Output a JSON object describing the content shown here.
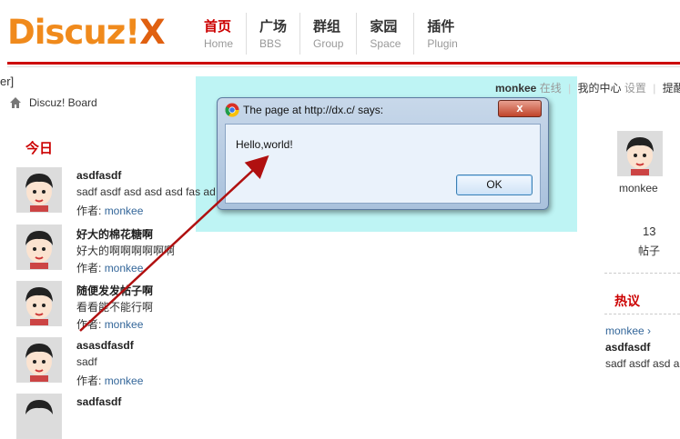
{
  "logo": {
    "text": "Discuz!",
    "mark": "X"
  },
  "nav": [
    {
      "zh": "首页",
      "en": "Home",
      "active": true
    },
    {
      "zh": "广场",
      "en": "BBS"
    },
    {
      "zh": "群组",
      "en": "Group"
    },
    {
      "zh": "家园",
      "en": "Space"
    },
    {
      "zh": "插件",
      "en": "Plugin"
    }
  ],
  "left_cut_text": "er]",
  "userbar": {
    "username": "monkee",
    "status": "在线",
    "center": "我的中心",
    "settings": "设置",
    "remind": "提醒"
  },
  "breadcrumb": {
    "label": "Discuz! Board"
  },
  "section_title": "今日",
  "author_label": "作者:",
  "posts": [
    {
      "title": "asdfasdf",
      "body": "sadf asdf asd asd asd fas ad",
      "author": "monkee"
    },
    {
      "title": "好大的棉花糖啊",
      "body": "好大的啊啊啊啊啊啊",
      "author": "monkee"
    },
    {
      "title": "随便发发帖子啊",
      "body": "看看能不能行啊",
      "author": "monkee"
    },
    {
      "title": "asasdfasdf",
      "body": "sadf",
      "author": "monkee"
    },
    {
      "title": "sadfasdf",
      "body": "",
      "author": ""
    }
  ],
  "sidebar": {
    "username": "monkee",
    "count": "13",
    "count_label": "帖子",
    "hot_title": "热议",
    "hot_user": "monkee ›",
    "hot_post_title": "asdfasdf",
    "hot_post_body": "sadf asdf asd a"
  },
  "dialog": {
    "title": "The page at http://dx.c/ says:",
    "message": "Hello,world!",
    "ok_label": "OK",
    "close_label": "x"
  },
  "colors": {
    "accent_red": "#cc0000",
    "link_blue": "#336699",
    "highlight": "#a8f0f0",
    "arrow": "#b01010"
  }
}
